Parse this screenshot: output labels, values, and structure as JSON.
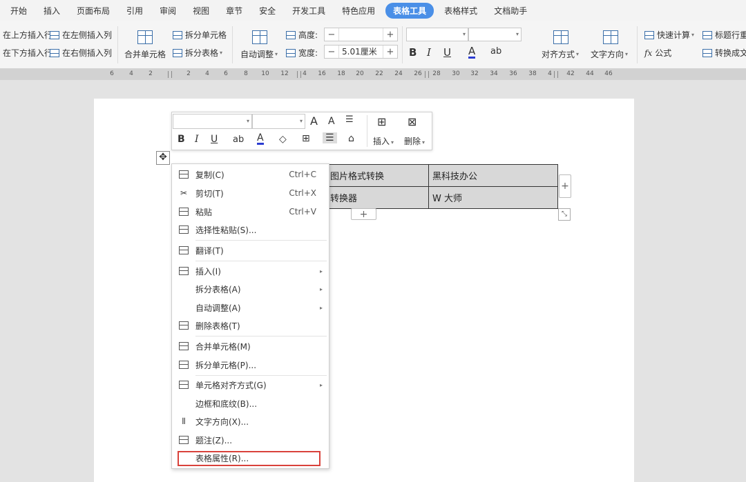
{
  "menubar": {
    "tabs": [
      {
        "label": "开始"
      },
      {
        "label": "插入"
      },
      {
        "label": "页面布局"
      },
      {
        "label": "引用"
      },
      {
        "label": "审阅"
      },
      {
        "label": "视图"
      },
      {
        "label": "章节"
      },
      {
        "label": "安全"
      },
      {
        "label": "开发工具"
      },
      {
        "label": "特色应用"
      },
      {
        "label": "表格工具"
      },
      {
        "label": "表格样式"
      },
      {
        "label": "文档助手"
      }
    ],
    "active_color": "#4a8fe7"
  },
  "ribbon": {
    "insert_row_above": "在上方插入行",
    "insert_row_below": "在下方插入行",
    "insert_col_left": "在左侧插入列",
    "insert_col_right": "在右侧插入列",
    "merge_cells": "合并单元格",
    "split_cells": "拆分单元格",
    "split_table": "拆分表格",
    "auto_fit": "自动调整",
    "height_label": "高度:",
    "width_label": "宽度:",
    "height_value": "",
    "width_value": "5.01厘米",
    "minus": "−",
    "plus": "+",
    "bold": "B",
    "italic": "I",
    "underline": "U",
    "font_color": "A",
    "highlight": "ab",
    "align": "对齐方式",
    "text_direction": "文字方向",
    "quick_calc": "快速计算",
    "formula_fx": "fx",
    "formula": "公式",
    "title_row_repeat": "标题行重",
    "convert_text": "转换成文"
  },
  "ruler": {
    "ticks": [
      "6",
      "4",
      "2",
      "2",
      "4",
      "6",
      "8",
      "10",
      "12",
      "4",
      "16",
      "18",
      "20",
      "22",
      "24",
      "26",
      "28",
      "30",
      "32",
      "34",
      "36",
      "38",
      "4",
      "42",
      "44",
      "46"
    ]
  },
  "table": {
    "rows": [
      [
        "图片格式转换",
        "黑科技办公"
      ],
      [
        "转换器",
        "W 大师"
      ]
    ],
    "add_row": "+",
    "add_col": "+",
    "move_handle": "✥",
    "resize_handle": "⤡"
  },
  "mini_toolbar": {
    "grow_font": "A",
    "shrink_font": "A",
    "bold": "B",
    "italic": "I",
    "underline": "U",
    "strikethrough": "ab",
    "font_color": "A",
    "insert": "插入",
    "delete": "删除"
  },
  "context_menu": {
    "items": [
      {
        "label": "复制(C)",
        "shortcut": "Ctrl+C"
      },
      {
        "label": "剪切(T)",
        "shortcut": "Ctrl+X"
      },
      {
        "label": "粘贴",
        "shortcut": "Ctrl+V"
      },
      {
        "label": "选择性粘贴(S)...",
        "shortcut": ""
      },
      {
        "label": "翻译(T)",
        "shortcut": ""
      },
      {
        "label": "插入(I)",
        "shortcut": ""
      },
      {
        "label": "拆分表格(A)",
        "shortcut": ""
      },
      {
        "label": "自动调整(A)",
        "shortcut": ""
      },
      {
        "label": "删除表格(T)",
        "shortcut": ""
      },
      {
        "label": "合并单元格(M)",
        "shortcut": ""
      },
      {
        "label": "拆分单元格(P)...",
        "shortcut": ""
      },
      {
        "label": "单元格对齐方式(G)",
        "shortcut": ""
      },
      {
        "label": "边框和底纹(B)...",
        "shortcut": ""
      },
      {
        "label": "文字方向(X)...",
        "shortcut": ""
      },
      {
        "label": "题注(Z)...",
        "shortcut": ""
      },
      {
        "label": "表格属性(R)...",
        "shortcut": ""
      }
    ],
    "highlight_color": "#d9413a"
  }
}
